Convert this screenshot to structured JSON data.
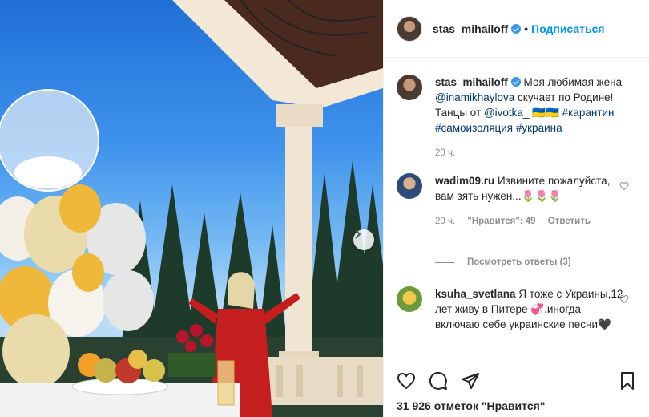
{
  "post": {
    "author": "stas_mihailoff",
    "separator": "•",
    "follow_label": "Подписаться"
  },
  "caption": {
    "username": "stas_mihailoff",
    "text_1": "Моя любимая жена",
    "mention_1": "@inamikhaylova",
    "text_2": "скучает по Родине! Танцы от",
    "mention_2": "@ivotka_",
    "emoji": "🇺🇦🇺🇦",
    "tag_1": "#карантин",
    "tag_2": "#самоизоляция",
    "tag_3": "#украина",
    "time": "20 ч."
  },
  "comments": [
    {
      "username": "wadim09.ru",
      "text": "Извините пожалуйста, вам зять нужен...🌷🌷🌷",
      "time": "20 ч.",
      "likes": "\"Нравится\": 49",
      "reply_label": "Ответить",
      "view_replies": "Посмотреть ответы (3)"
    },
    {
      "username": "ksuha_svetlana",
      "text": "Я тоже с Украины,12 лет живу в Питере 💞,иногда включаю себе украинские песни🖤"
    }
  ],
  "likes_count": "31 926 отметок \"Нравится\"",
  "icons": {
    "like": "heart-icon",
    "comment": "comment-icon",
    "share": "share-icon",
    "save": "bookmark-icon",
    "next": "chevron-right-icon"
  },
  "colors": {
    "accent": "#0095f6",
    "verified": "#3897f0",
    "muted": "#8e8e8e"
  }
}
